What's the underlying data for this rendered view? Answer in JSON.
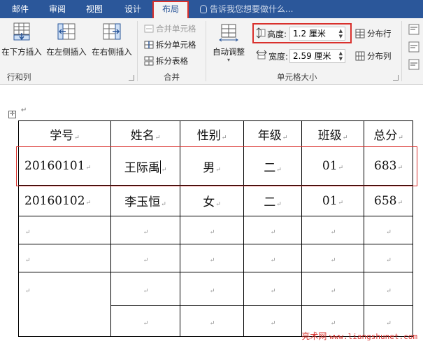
{
  "tabs": [
    {
      "label": "邮件"
    },
    {
      "label": "审阅"
    },
    {
      "label": "视图"
    },
    {
      "label": "设计"
    },
    {
      "label": "布局",
      "active": true
    }
  ],
  "tell_me": "告诉我您想要做什么...",
  "ribbon": {
    "rows_cols": {
      "insert_below": "在下方插入",
      "insert_left": "在左侧插入",
      "insert_right": "在右侧插入",
      "group_label": "行和列"
    },
    "merge": {
      "merge_cells": "合并单元格",
      "split_cells": "拆分单元格",
      "split_table": "拆分表格",
      "group_label": "合并"
    },
    "cell_size": {
      "autofit": "自动调整",
      "height_label": "高度:",
      "height_value": "1.2 厘米",
      "width_label": "宽度:",
      "width_value": "2.59 厘米",
      "distribute_rows": "分布行",
      "distribute_cols": "分布列",
      "group_label": "单元格大小"
    }
  },
  "paragraph_mark": "↵",
  "table": {
    "header": [
      "学号",
      "姓名",
      "性别",
      "年级",
      "班级",
      "总分"
    ],
    "rows": [
      [
        "20160101",
        "王际禹",
        "男",
        "二",
        "01",
        "683"
      ],
      [
        "20160102",
        "李玉恒",
        "女",
        "二",
        "01",
        "658"
      ]
    ]
  },
  "watermark": {
    "brand": "亮术网",
    "url": "www.liangshunet.com"
  },
  "colors": {
    "tabbar": "#2b579a",
    "highlight": "#d9302c",
    "ribbon_bg": "#f3f3f3"
  }
}
